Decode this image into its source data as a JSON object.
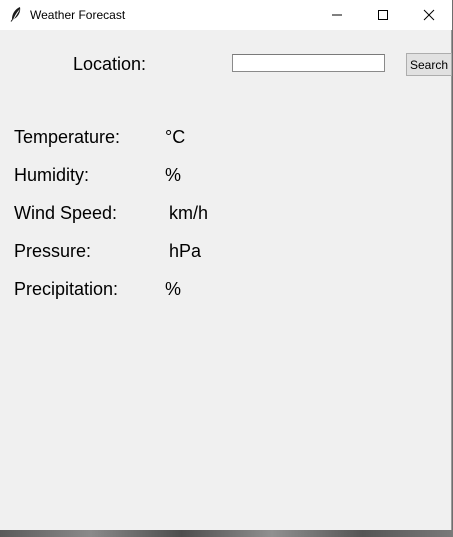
{
  "window": {
    "title": "Weather Forecast",
    "icon": "feather-icon"
  },
  "form": {
    "location_label": "Location:",
    "search_value": "",
    "search_placeholder": "",
    "search_button_label": "Search"
  },
  "readings": [
    {
      "label": "Temperature:",
      "value": "",
      "unit": "°C"
    },
    {
      "label": "Humidity:",
      "value": "",
      "unit": "%"
    },
    {
      "label": "Wind Speed:",
      "value": "",
      "unit": "km/h"
    },
    {
      "label": "Pressure:",
      "value": "",
      "unit": "hPa"
    },
    {
      "label": "Precipitation:",
      "value": "",
      "unit": "%"
    }
  ]
}
